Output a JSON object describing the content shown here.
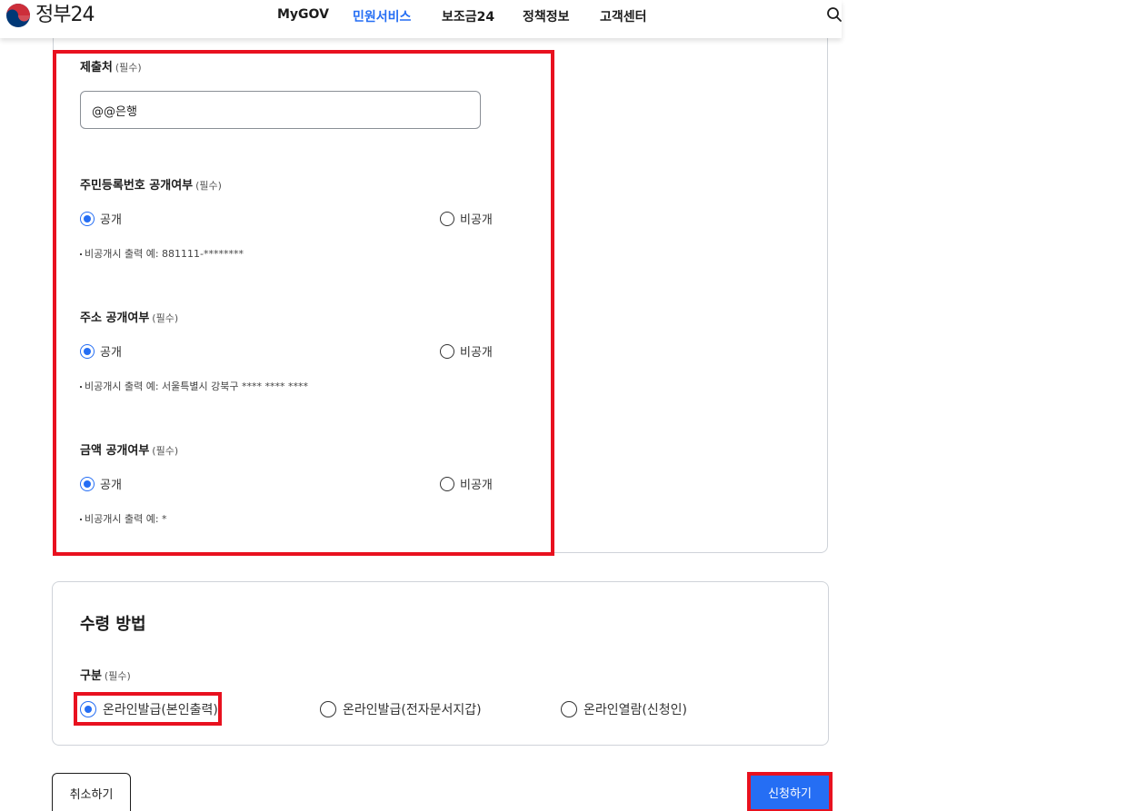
{
  "header": {
    "logo_text": "정부24",
    "nav": [
      {
        "label": "MyGOV",
        "active": false
      },
      {
        "label": "민원서비스",
        "active": true
      },
      {
        "label": "보조금24",
        "active": false
      },
      {
        "label": "정책정보",
        "active": false
      },
      {
        "label": "고객센터",
        "active": false
      }
    ]
  },
  "form": {
    "required_mark": "(필수)",
    "submit_to": {
      "label": "제출처",
      "value": "@@은행"
    },
    "rrn_disclosure": {
      "label": "주민등록번호 공개여부",
      "options": [
        "공개",
        "비공개"
      ],
      "selected": "공개",
      "help": "비공개시 출력 예: 881111-********"
    },
    "address_disclosure": {
      "label": "주소 공개여부",
      "options": [
        "공개",
        "비공개"
      ],
      "selected": "공개",
      "help": "비공개시 출력 예: 서울특별시 강북구 **** **** ****"
    },
    "amount_disclosure": {
      "label": "금액 공개여부",
      "options": [
        "공개",
        "비공개"
      ],
      "selected": "공개",
      "help": "비공개시 출력 예: *"
    }
  },
  "receive": {
    "title": "수령 방법",
    "category_label": "구분",
    "options": [
      "온라인발급(본인출력)",
      "온라인발급(전자문서지갑)",
      "온라인열람(신청인)"
    ],
    "selected": "온라인발급(본인출력)"
  },
  "actions": {
    "cancel": "취소하기",
    "submit": "신청하기"
  },
  "colors": {
    "accent": "#256ef4",
    "highlight": "#e8111f"
  }
}
